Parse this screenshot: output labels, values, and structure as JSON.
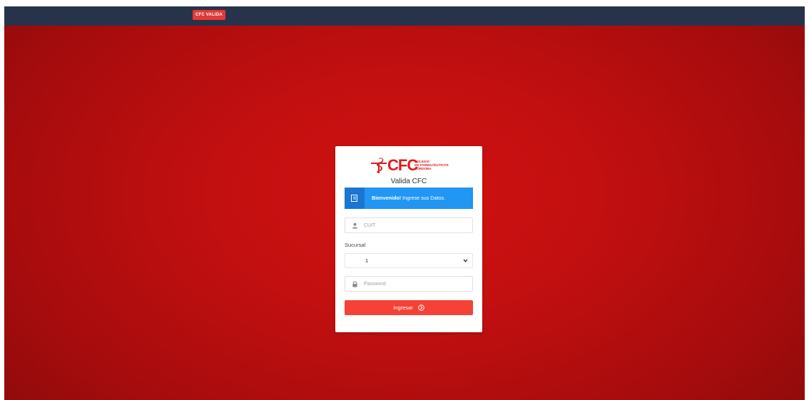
{
  "topbar": {
    "brand": "CFC VALIDA"
  },
  "logo": {
    "mark": "CFC",
    "sub": [
      "COLEGIO",
      "DE FARMACÉUTICOS",
      "CÓRDOBA"
    ]
  },
  "login": {
    "title": "Valida CFC",
    "alert_bold": "Bienvenido!",
    "alert_text": " Ingrese sus Datos.",
    "cuit_placeholder": "CUIT",
    "sucursal_label": "Sucursal",
    "sucursal_value": "1",
    "password_placeholder": "Password",
    "submit_label": "Ingresar"
  },
  "colors": {
    "topbar": "#27334a",
    "background": "#c20f10",
    "accent": "#f44336",
    "alert": "#2196f3"
  }
}
